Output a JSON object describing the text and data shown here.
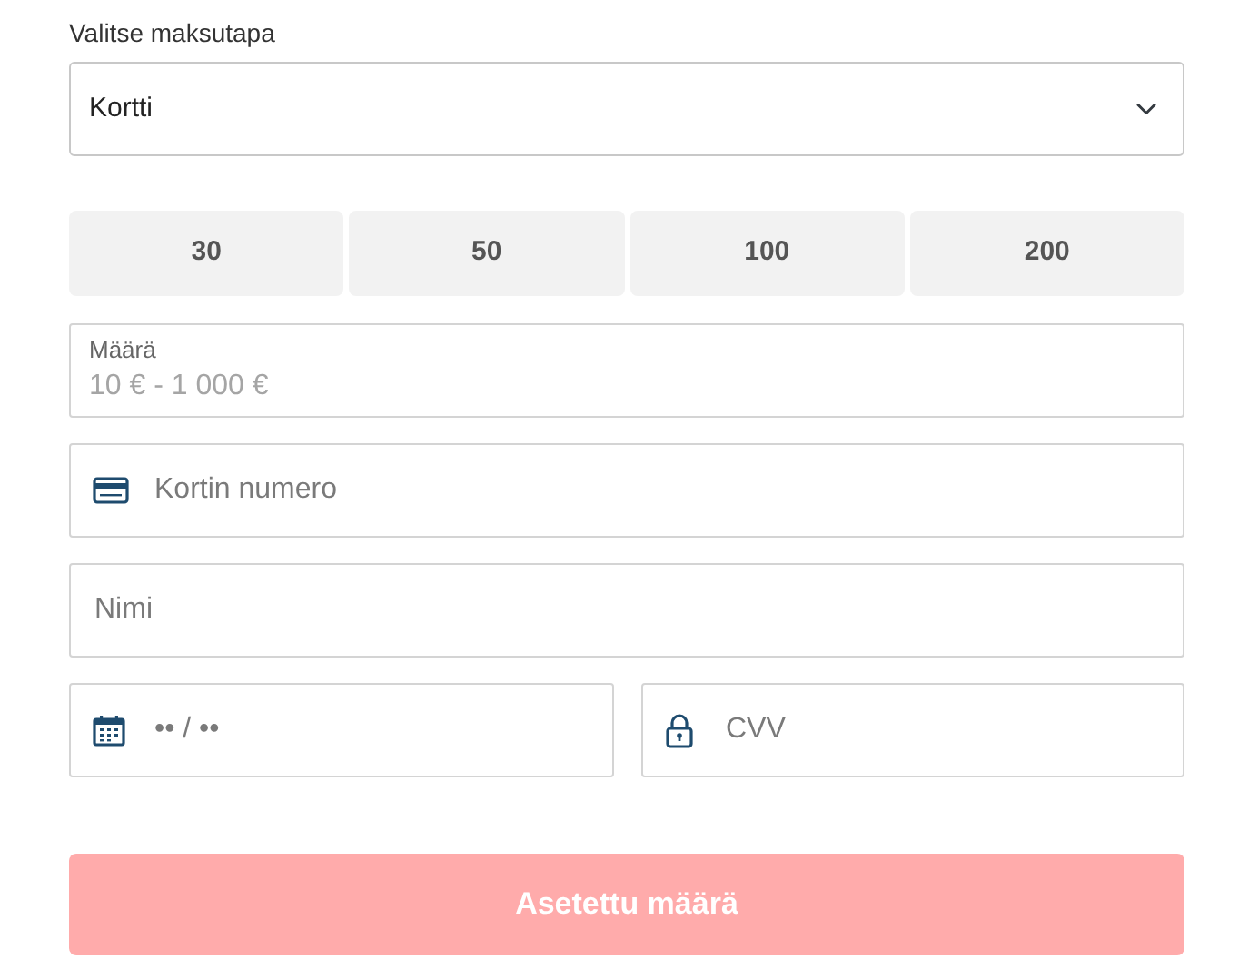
{
  "payment_method": {
    "label": "Valitse maksutapa",
    "value": "Kortti"
  },
  "amount_buttons": [
    {
      "label": "30",
      "selected": false
    },
    {
      "label": "50",
      "selected": false
    },
    {
      "label": "100",
      "selected": false
    },
    {
      "label": "200",
      "selected": false
    }
  ],
  "amount_field": {
    "label": "Määrä",
    "placeholder": "10 € - 1 000 €"
  },
  "card_fields": [
    {
      "kind": "card",
      "placeholder": "Kortin numero"
    },
    {
      "kind": "name",
      "placeholder": "Nimi"
    }
  ],
  "split_fields": [
    {
      "kind": "expiry",
      "placeholder": "•• / ••"
    },
    {
      "kind": "cvv",
      "placeholder": "CVV"
    }
  ],
  "submit": {
    "label": "Asetettu määrä",
    "disabled": true
  }
}
